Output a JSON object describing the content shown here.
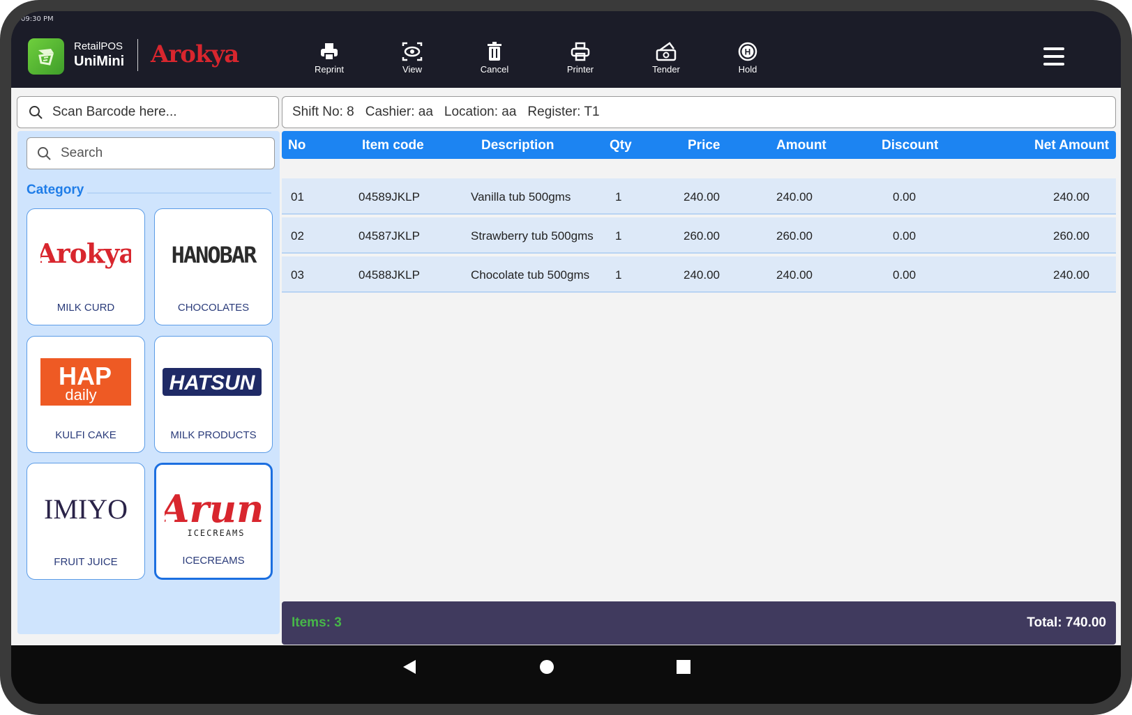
{
  "status": {
    "time": "09:30 PM"
  },
  "header": {
    "brand_line1": "RetailPOS",
    "brand_line2": "UniMini",
    "partner_logo": "Arokya",
    "tools": [
      {
        "label": "Reprint",
        "icon": "reprint-icon"
      },
      {
        "label": "View",
        "icon": "view-icon"
      },
      {
        "label": "Cancel",
        "icon": "trash-icon"
      },
      {
        "label": "Printer",
        "icon": "printer-icon"
      },
      {
        "label": "Tender",
        "icon": "tender-icon"
      },
      {
        "label": "Hold",
        "icon": "hold-icon"
      }
    ],
    "menu_icon": "hamburger-menu-icon"
  },
  "barcode": {
    "placeholder": "Scan Barcode here..."
  },
  "info": {
    "shift": "Shift No: 8",
    "cashier": "Cashier: aa",
    "location": "Location: aa",
    "register": "Register: T1"
  },
  "sidebar": {
    "search_placeholder": "Search",
    "category_title": "Category",
    "categories": [
      {
        "name": "MILK CURD",
        "brand": "Arokya"
      },
      {
        "name": "CHOCOLATES",
        "brand": "HANOBAR"
      },
      {
        "name": "KULFI CAKE",
        "brand": "HAP daily"
      },
      {
        "name": "MILK PRODUCTS",
        "brand": "HATSUN"
      },
      {
        "name": "FRUIT JUICE",
        "brand": "IMIYO"
      },
      {
        "name": "ICECREAMS",
        "brand": "Arun ICECREAMS"
      }
    ],
    "active_category": "ICECREAMS"
  },
  "table": {
    "columns": [
      "No",
      "Item code",
      "Description",
      "Qty",
      "Price",
      "Amount",
      "Discount",
      "Net Amount"
    ],
    "rows": [
      [
        "01",
        "04589JKLP",
        "Vanilla tub 500gms",
        "1",
        "240.00",
        "240.00",
        "0.00",
        "240.00"
      ],
      [
        "02",
        "04587JKLP",
        "Strawberry tub 500gms",
        "1",
        "260.00",
        "260.00",
        "0.00",
        "260.00"
      ],
      [
        "03",
        "04588JKLP",
        "Chocolate tub 500gms",
        "1",
        "240.00",
        "240.00",
        "0.00",
        "240.00"
      ]
    ]
  },
  "footer": {
    "items": "Items: 3",
    "total": "Total: 740.00"
  },
  "colors": {
    "header_bg": "#1b1c28",
    "accent_blue": "#1c84f2",
    "sidebar_bg": "#cfe4fd",
    "footer_bg": "#403a5e",
    "items_green": "#47b649",
    "brand_red": "#d8262e"
  }
}
